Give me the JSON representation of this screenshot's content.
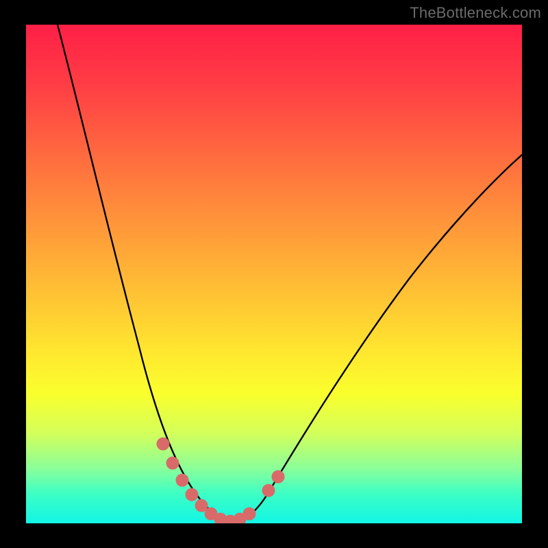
{
  "watermark": "TheBottleneck.com",
  "colors": {
    "page_bg": "#000000",
    "gradient_top": "#ff1f47",
    "gradient_bottom": "#11f5e6",
    "curve_stroke": "#000000",
    "marker_fill": "#d86a6a",
    "watermark_text": "#6b6b6b"
  },
  "chart_data": {
    "type": "line",
    "title": "",
    "xlabel": "",
    "ylabel": "",
    "xlim": [
      0,
      1
    ],
    "ylim": [
      0,
      1
    ],
    "series": [
      {
        "name": "bottleneck-curve",
        "x": [
          0.0,
          0.05,
          0.1,
          0.15,
          0.2,
          0.25,
          0.3,
          0.34,
          0.38,
          0.4,
          0.45,
          0.49,
          0.6,
          0.7,
          0.8,
          0.9,
          1.0
        ],
        "values": [
          1.0,
          0.89,
          0.75,
          0.6,
          0.45,
          0.31,
          0.18,
          0.08,
          0.02,
          0.0,
          0.02,
          0.08,
          0.22,
          0.36,
          0.49,
          0.6,
          0.7
        ]
      }
    ],
    "markers": {
      "name": "highlighted-points",
      "x": [
        0.275,
        0.3,
        0.325,
        0.345,
        0.365,
        0.385,
        0.405,
        0.425,
        0.445,
        0.465,
        0.49,
        0.51
      ],
      "values": [
        0.155,
        0.11,
        0.075,
        0.05,
        0.03,
        0.015,
        0.01,
        0.01,
        0.02,
        0.04,
        0.07,
        0.095
      ]
    },
    "legend": null,
    "grid": false
  }
}
